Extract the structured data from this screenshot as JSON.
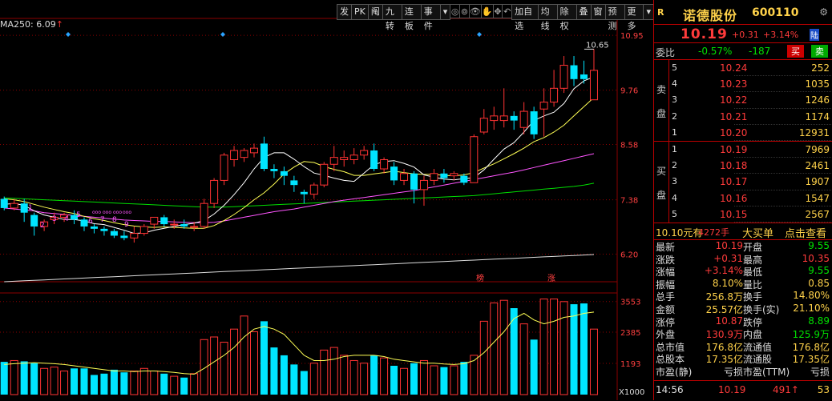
{
  "toolbar": {
    "buttons": [
      "发",
      "PK",
      "阄",
      "九转",
      "连板",
      "事件",
      "▾",
      "加自选",
      "均线",
      "除权",
      "叠",
      "窗",
      "预测",
      "更多",
      "▾"
    ],
    "icons": [
      "circle-icon",
      "target-icon",
      "eye-icon",
      "hand-icon",
      "move-icon",
      "undo-icon"
    ]
  },
  "ma250_label": "MA250: 6.09",
  "ma250_arrow": "↑",
  "price_axis": [
    "10.95",
    "9.76",
    "8.58",
    "7.38",
    "6.20"
  ],
  "vol_axis": [
    "3553",
    "2385",
    "1193",
    "X1000"
  ],
  "annotations": {
    "high_label": "10.65",
    "tag_bang": "榜",
    "tag_zhang": "涨",
    "wave_numbers": [
      "1",
      "2",
      "3",
      "4",
      "5",
      "6",
      "7",
      "8",
      "9"
    ]
  },
  "colors": {
    "up": "#ff3333",
    "down": "#00e5ff",
    "ma5": "#ffffff",
    "ma10": "#ffff55",
    "ma20": "#ff55ff",
    "ma60": "#00dd00",
    "ma250": "#dddddd",
    "grid": "#8b0000"
  },
  "panel": {
    "R": "R",
    "name": "诺德股份",
    "code": "600110",
    "price": "10.19",
    "change": "+0.31",
    "change_pct": "+3.14%",
    "exchange_badge": "陆",
    "webi_label": "委比",
    "webi_pct": "-0.57%",
    "webi_diff": "-187",
    "buy_btn": "买",
    "sell_btn": "卖",
    "sell_side": "卖盘",
    "buy_side": "买盘",
    "asks": [
      {
        "lv": "5",
        "price": "10.24",
        "vol": "252"
      },
      {
        "lv": "4",
        "price": "10.23",
        "vol": "1035"
      },
      {
        "lv": "3",
        "price": "10.22",
        "vol": "1246"
      },
      {
        "lv": "2",
        "price": "10.21",
        "vol": "1174"
      },
      {
        "lv": "1",
        "price": "10.20",
        "vol": "12931"
      }
    ],
    "bids": [
      {
        "lv": "1",
        "price": "10.19",
        "vol": "7969"
      },
      {
        "lv": "2",
        "price": "10.18",
        "vol": "2461"
      },
      {
        "lv": "3",
        "price": "10.17",
        "vol": "1907"
      },
      {
        "lv": "4",
        "price": "10.16",
        "vol": "1547"
      },
      {
        "lv": "5",
        "price": "10.15",
        "vol": "2567"
      }
    ],
    "deal": {
      "price": "10.10元有",
      "vol": "4272手",
      "big": "大买单",
      "link": "点击查看"
    },
    "stats": [
      {
        "l1": "最新",
        "v1": "10.19",
        "c1": "red",
        "l2": "开盘",
        "v2": "9.55",
        "c2": "grn"
      },
      {
        "l1": "涨跌",
        "v1": "+0.31",
        "c1": "red",
        "l2": "最高",
        "v2": "10.35",
        "c2": "red"
      },
      {
        "l1": "涨幅",
        "v1": "+3.14%",
        "c1": "red",
        "l2": "最低",
        "v2": "9.55",
        "c2": "grn"
      },
      {
        "l1": "振幅",
        "v1": "8.10%",
        "c1": "yel",
        "l2": "量比",
        "v2": "0.85",
        "c2": "yel"
      },
      {
        "l1": "总手",
        "v1": "256.8万",
        "c1": "yel",
        "l2": "换手",
        "v2": "14.80%",
        "c2": "yel"
      },
      {
        "l1": "金额",
        "v1": "25.57亿",
        "c1": "yel",
        "l2": "换手(实)",
        "v2": "21.10%",
        "c2": "yel"
      },
      {
        "l1": "涨停",
        "v1": "10.87",
        "c1": "red",
        "l2": "跌停",
        "v2": "8.89",
        "c2": "grn"
      },
      {
        "l1": "外盘",
        "v1": "130.9万",
        "c1": "red",
        "l2": "内盘",
        "v2": "125.9万",
        "c2": "grn"
      },
      {
        "l1": "总市值",
        "v1": "176.8亿",
        "c1": "yel",
        "l2": "流通值",
        "v2": "176.8亿",
        "c2": "yel"
      },
      {
        "l1": "总股本",
        "v1": "17.35亿",
        "c1": "yel",
        "l2": "流通股",
        "v2": "17.35亿",
        "c2": "yel"
      },
      {
        "l1": "市盈(静)",
        "v1": "亏损",
        "c1": "wht",
        "l2": "市盈(TTM)",
        "v2": "亏损",
        "c2": "wht"
      }
    ],
    "footer": {
      "time": "14:56",
      "price": "10.19",
      "vol": "491",
      "arrow": "↑",
      "n": "53"
    }
  },
  "chart_data": {
    "type": "candlestick",
    "price_ylim": [
      5.6,
      11.3
    ],
    "volume_ylim": [
      0,
      3850
    ],
    "candles": [
      {
        "o": 7.4,
        "c": 7.2,
        "h": 7.45,
        "l": 7.15,
        "v": 1250
      },
      {
        "o": 7.2,
        "c": 7.3,
        "h": 7.4,
        "l": 7.15,
        "v": 1300
      },
      {
        "o": 7.3,
        "c": 7.1,
        "h": 7.4,
        "l": 6.9,
        "v": 1270
      },
      {
        "o": 7.05,
        "c": 6.8,
        "h": 7.1,
        "l": 6.6,
        "v": 1200
      },
      {
        "o": 6.8,
        "c": 6.9,
        "h": 6.95,
        "l": 6.7,
        "v": 1000
      },
      {
        "o": 6.95,
        "c": 7.0,
        "h": 7.1,
        "l": 6.85,
        "v": 1050
      },
      {
        "o": 7.0,
        "c": 7.05,
        "h": 7.1,
        "l": 6.9,
        "v": 900
      },
      {
        "o": 7.05,
        "c": 6.95,
        "h": 7.15,
        "l": 6.85,
        "v": 1000
      },
      {
        "o": 6.95,
        "c": 6.8,
        "h": 7.0,
        "l": 6.7,
        "v": 1000
      },
      {
        "o": 6.8,
        "c": 6.75,
        "h": 6.85,
        "l": 6.65,
        "v": 750
      },
      {
        "o": 6.75,
        "c": 6.7,
        "h": 6.8,
        "l": 6.6,
        "v": 800
      },
      {
        "o": 6.7,
        "c": 6.6,
        "h": 6.75,
        "l": 6.55,
        "v": 950
      },
      {
        "o": 6.6,
        "c": 6.55,
        "h": 6.7,
        "l": 6.5,
        "v": 850
      },
      {
        "o": 6.55,
        "c": 6.65,
        "h": 6.8,
        "l": 6.45,
        "v": 900
      },
      {
        "o": 6.65,
        "c": 6.8,
        "h": 6.85,
        "l": 6.6,
        "v": 1000
      },
      {
        "o": 6.85,
        "c": 7.0,
        "h": 7.0,
        "l": 6.75,
        "v": 900
      },
      {
        "o": 7.0,
        "c": 6.85,
        "h": 7.05,
        "l": 6.8,
        "v": 800
      },
      {
        "o": 6.85,
        "c": 6.85,
        "h": 6.95,
        "l": 6.75,
        "v": 700
      },
      {
        "o": 6.85,
        "c": 6.8,
        "h": 6.95,
        "l": 6.75,
        "v": 650
      },
      {
        "o": 6.8,
        "c": 6.8,
        "h": 6.9,
        "l": 6.7,
        "v": 800
      },
      {
        "o": 6.8,
        "c": 7.3,
        "h": 7.4,
        "l": 6.75,
        "v": 2100
      },
      {
        "o": 7.3,
        "c": 7.8,
        "h": 7.85,
        "l": 7.2,
        "v": 2200
      },
      {
        "o": 7.8,
        "c": 8.35,
        "h": 8.4,
        "l": 7.7,
        "v": 2000
      },
      {
        "o": 8.25,
        "c": 8.45,
        "h": 8.55,
        "l": 8.1,
        "v": 2500
      },
      {
        "o": 8.3,
        "c": 8.45,
        "h": 8.5,
        "l": 8.2,
        "v": 3000
      },
      {
        "o": 8.4,
        "c": 8.5,
        "h": 8.6,
        "l": 8.3,
        "v": 2400
      },
      {
        "o": 8.6,
        "c": 8.05,
        "h": 8.75,
        "l": 8.0,
        "v": 2800
      },
      {
        "o": 8.05,
        "c": 8.0,
        "h": 8.15,
        "l": 7.85,
        "v": 1800
      },
      {
        "o": 8.0,
        "c": 7.9,
        "h": 8.1,
        "l": 7.7,
        "v": 1500
      },
      {
        "o": 7.8,
        "c": 7.7,
        "h": 7.9,
        "l": 7.55,
        "v": 1150
      },
      {
        "o": 7.55,
        "c": 7.5,
        "h": 7.6,
        "l": 7.3,
        "v": 900
      },
      {
        "o": 7.5,
        "c": 7.7,
        "h": 7.75,
        "l": 7.4,
        "v": 1200
      },
      {
        "o": 7.7,
        "c": 8.15,
        "h": 8.2,
        "l": 7.65,
        "v": 1700
      },
      {
        "o": 8.15,
        "c": 8.3,
        "h": 8.55,
        "l": 8.0,
        "v": 1800
      },
      {
        "o": 8.25,
        "c": 8.3,
        "h": 8.45,
        "l": 8.1,
        "v": 1500
      },
      {
        "o": 8.25,
        "c": 8.35,
        "h": 8.5,
        "l": 8.15,
        "v": 1300
      },
      {
        "o": 8.35,
        "c": 8.45,
        "h": 8.55,
        "l": 8.25,
        "v": 1200
      },
      {
        "o": 8.45,
        "c": 8.05,
        "h": 8.6,
        "l": 8.0,
        "v": 1500
      },
      {
        "o": 8.05,
        "c": 8.25,
        "h": 8.3,
        "l": 7.95,
        "v": 1400
      },
      {
        "o": 8.1,
        "c": 7.8,
        "h": 8.2,
        "l": 7.7,
        "v": 1100
      },
      {
        "o": 7.8,
        "c": 7.95,
        "h": 8.05,
        "l": 7.7,
        "v": 1000
      },
      {
        "o": 7.95,
        "c": 7.6,
        "h": 8.0,
        "l": 7.3,
        "v": 1200
      },
      {
        "o": 7.6,
        "c": 7.8,
        "h": 7.9,
        "l": 7.25,
        "v": 1300
      },
      {
        "o": 7.8,
        "c": 7.95,
        "h": 8.05,
        "l": 7.7,
        "v": 1100
      },
      {
        "o": 7.95,
        "c": 7.85,
        "h": 8.05,
        "l": 7.75,
        "v": 1050
      },
      {
        "o": 7.9,
        "c": 7.95,
        "h": 8.0,
        "l": 7.8,
        "v": 1100
      },
      {
        "o": 7.9,
        "c": 7.75,
        "h": 7.95,
        "l": 7.7,
        "v": 1250
      },
      {
        "o": 7.75,
        "c": 8.75,
        "h": 8.8,
        "l": 7.75,
        "v": 1500
      },
      {
        "o": 8.85,
        "c": 9.15,
        "h": 9.35,
        "l": 8.8,
        "v": 2800
      },
      {
        "o": 9.1,
        "c": 9.2,
        "h": 9.4,
        "l": 8.9,
        "v": 3500
      },
      {
        "o": 9.1,
        "c": 9.2,
        "h": 9.8,
        "l": 8.95,
        "v": 3600
      },
      {
        "o": 9.2,
        "c": 9.1,
        "h": 9.3,
        "l": 8.9,
        "v": 3300
      },
      {
        "o": 8.95,
        "c": 9.3,
        "h": 9.5,
        "l": 8.8,
        "v": 2700
      },
      {
        "o": 9.3,
        "c": 8.8,
        "h": 9.4,
        "l": 8.7,
        "v": 2100
      },
      {
        "o": 9.35,
        "c": 9.5,
        "h": 9.8,
        "l": 8.75,
        "v": 3650
      },
      {
        "o": 9.5,
        "c": 9.8,
        "h": 10.2,
        "l": 9.4,
        "v": 3650
      },
      {
        "o": 9.8,
        "c": 10.3,
        "h": 10.5,
        "l": 9.7,
        "v": 3550
      },
      {
        "o": 10.3,
        "c": 10.0,
        "h": 10.5,
        "l": 9.85,
        "v": 3450
      },
      {
        "o": 10.1,
        "c": 10.0,
        "h": 10.4,
        "l": 9.9,
        "v": 3480
      },
      {
        "o": 9.55,
        "c": 10.19,
        "h": 10.65,
        "l": 9.55,
        "v": 2500
      }
    ],
    "ma_lines": {
      "ma5": [
        7.28,
        7.3,
        7.26,
        7.14,
        7.05,
        7.0,
        6.95,
        6.95,
        6.92,
        6.86,
        6.84,
        6.78,
        6.72,
        6.65,
        6.66,
        6.72,
        6.76,
        6.8,
        6.84,
        6.87,
        6.93,
        7.07,
        7.26,
        7.49,
        7.75,
        8.05,
        8.3,
        8.4,
        8.4,
        8.26,
        8.1,
        7.96,
        7.91,
        7.85,
        7.8,
        7.78,
        7.96,
        8.14,
        8.21,
        8.23,
        8.17,
        8.09,
        7.92,
        7.87,
        7.83,
        7.81,
        7.84,
        7.86,
        8.03,
        8.26,
        8.48,
        8.62,
        8.85,
        9.1,
        9.2,
        9.28,
        9.47,
        9.79,
        9.96,
        10.05
      ],
      "ma10": [
        7.4,
        7.38,
        7.34,
        7.28,
        7.22,
        7.17,
        7.12,
        7.08,
        7.02,
        6.97,
        6.93,
        6.88,
        6.84,
        6.81,
        6.79,
        6.78,
        6.79,
        6.78,
        6.77,
        6.76,
        6.76,
        6.82,
        6.93,
        7.06,
        7.21,
        7.38,
        7.53,
        7.72,
        7.94,
        8.09,
        8.21,
        8.19,
        8.1,
        8.04,
        7.99,
        7.91,
        7.91,
        7.94,
        7.97,
        8.0,
        7.97,
        7.94,
        7.93,
        7.93,
        7.91,
        7.9,
        7.92,
        7.97,
        8.07,
        8.16,
        8.27,
        8.38,
        8.5,
        8.64,
        8.73,
        8.85,
        9.0,
        9.2,
        9.4,
        9.6
      ],
      "ma20": [
        7.2,
        7.18,
        7.16,
        7.14,
        7.1,
        7.08,
        7.06,
        7.04,
        7.02,
        7.0,
        6.98,
        6.96,
        6.94,
        6.93,
        6.92,
        6.91,
        6.91,
        6.9,
        6.89,
        6.88,
        6.88,
        6.89,
        6.92,
        6.96,
        7.0,
        7.04,
        7.08,
        7.12,
        7.15,
        7.18,
        7.22,
        7.26,
        7.3,
        7.34,
        7.37,
        7.4,
        7.43,
        7.46,
        7.49,
        7.52,
        7.55,
        7.58,
        7.62,
        7.66,
        7.7,
        7.74,
        7.78,
        7.82,
        7.86,
        7.9,
        7.94,
        7.98,
        8.03,
        8.08,
        8.13,
        8.18,
        8.23,
        8.28,
        8.33,
        8.38
      ],
      "ma60": [
        7.42,
        7.41,
        7.4,
        7.39,
        7.38,
        7.37,
        7.36,
        7.35,
        7.34,
        7.33,
        7.32,
        7.31,
        7.3,
        7.29,
        7.28,
        7.27,
        7.26,
        7.25,
        7.24,
        7.23,
        7.22,
        7.22,
        7.22,
        7.23,
        7.24,
        7.25,
        7.26,
        7.27,
        7.28,
        7.29,
        7.3,
        7.31,
        7.32,
        7.33,
        7.34,
        7.35,
        7.36,
        7.37,
        7.38,
        7.39,
        7.4,
        7.41,
        7.42,
        7.43,
        7.44,
        7.45,
        7.46,
        7.47,
        7.49,
        7.51,
        7.53,
        7.55,
        7.57,
        7.59,
        7.61,
        7.63,
        7.65,
        7.67,
        7.7,
        7.74
      ],
      "ma250": [
        5.6,
        5.61,
        5.62,
        5.63,
        5.64,
        5.65,
        5.66,
        5.67,
        5.68,
        5.69,
        5.7,
        5.71,
        5.72,
        5.73,
        5.74,
        5.75,
        5.76,
        5.77,
        5.78,
        5.79,
        5.8,
        5.81,
        5.82,
        5.83,
        5.84,
        5.85,
        5.86,
        5.87,
        5.88,
        5.89,
        5.9,
        5.91,
        5.92,
        5.93,
        5.94,
        5.95,
        5.96,
        5.97,
        5.98,
        5.99,
        6.0,
        6.01,
        6.02,
        6.03,
        6.04,
        6.05,
        6.06,
        6.07,
        6.08,
        6.09,
        6.1,
        6.11,
        6.12,
        6.13,
        6.14,
        6.15,
        6.16,
        6.17,
        6.18,
        6.19
      ],
      "vol_ma5": [
        1150,
        1180,
        1200,
        1220,
        1200,
        1180,
        1150,
        1100,
        1050,
        1000,
        950,
        900,
        900,
        880,
        900,
        900,
        880,
        850,
        800,
        780,
        1000,
        1250,
        1500,
        1800,
        2200,
        2500,
        2600,
        2500,
        2300,
        1900,
        1500,
        1300,
        1300,
        1350,
        1450,
        1500,
        1500,
        1500,
        1450,
        1350,
        1300,
        1250,
        1200,
        1200,
        1170,
        1150,
        1180,
        1300,
        1600,
        2000,
        2400,
        2900,
        3100,
        2850,
        2700,
        2800,
        2950,
        3000,
        3100,
        3150
      ]
    }
  }
}
